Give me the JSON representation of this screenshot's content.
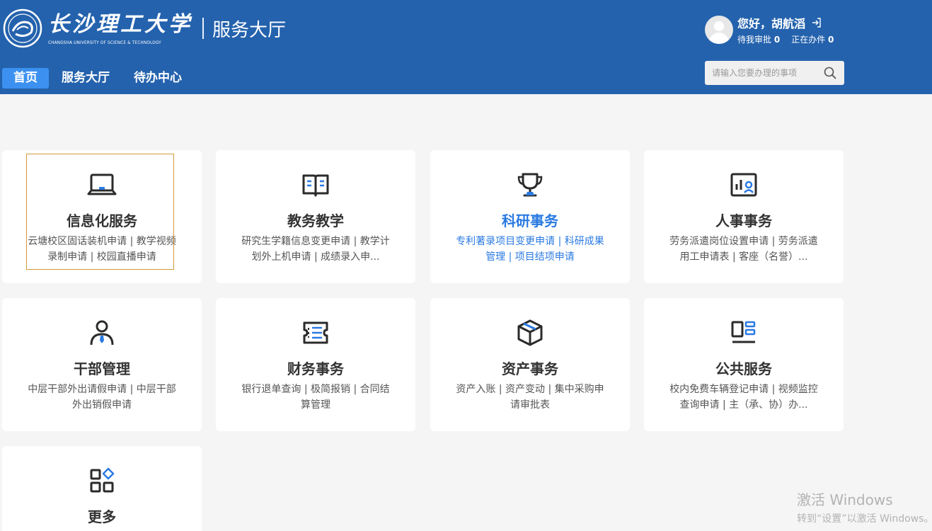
{
  "header": {
    "logo_cn": "长沙理工大学",
    "logo_en": "CHANGSHA UNIVERSITY OF SCIENCE & TECHNOLOGY",
    "portal_name": "服务大厅",
    "bg_color": "#2462ad"
  },
  "user": {
    "greeting": "您好，胡航滔",
    "pending_label": "待我审批",
    "pending_count": "0",
    "in_progress_label": "正在办件",
    "in_progress_count": "0"
  },
  "nav": {
    "items": [
      {
        "label": "首页",
        "active": true
      },
      {
        "label": "服务大厅",
        "active": false
      },
      {
        "label": "待办中心",
        "active": false
      }
    ]
  },
  "search": {
    "placeholder": "请输入您要办理的事项",
    "value": ""
  },
  "cards": [
    {
      "title": "信息化服务",
      "desc": "云塘校区固话装机申请 | 教学视频录制申请 | 校园直播申请",
      "icon": "laptop-icon"
    },
    {
      "title": "教务教学",
      "desc": "研究生学籍信息变更申请 | 教学计划外上机申请 | 成绩录入申...",
      "icon": "book-icon"
    },
    {
      "title": "科研事务",
      "desc": "专利著录项目变更申请 | 科研成果管理 | 项目结项申请",
      "icon": "trophy-icon"
    },
    {
      "title": "人事事务",
      "desc": "劳务派遣岗位设置申请 | 劳务派遣用工申请表 | 客座（名誉）...",
      "icon": "chart-person-icon"
    },
    {
      "title": "干部管理",
      "desc": "中层干部外出请假申请 | 中层干部外出销假申请",
      "icon": "person-tie-icon"
    },
    {
      "title": "财务事务",
      "desc": "银行退单查询 | 极简报销 | 合同结算管理",
      "icon": "ticket-icon"
    },
    {
      "title": "资产事务",
      "desc": "资产入账 | 资产变动 | 集中采购申请审批表",
      "icon": "box-icon"
    },
    {
      "title": "公共服务",
      "desc": "校内免费车辆登记申请 | 视频监控查询申请 | 主（承、协）办...",
      "icon": "layout-icon"
    },
    {
      "title": "更多",
      "desc": "",
      "icon": "grid-more-icon"
    }
  ],
  "accent_color": "#2a7ae2",
  "watermark": {
    "line1": "激活 Windows",
    "line2": "转到“设置”以激活 Windows。"
  }
}
